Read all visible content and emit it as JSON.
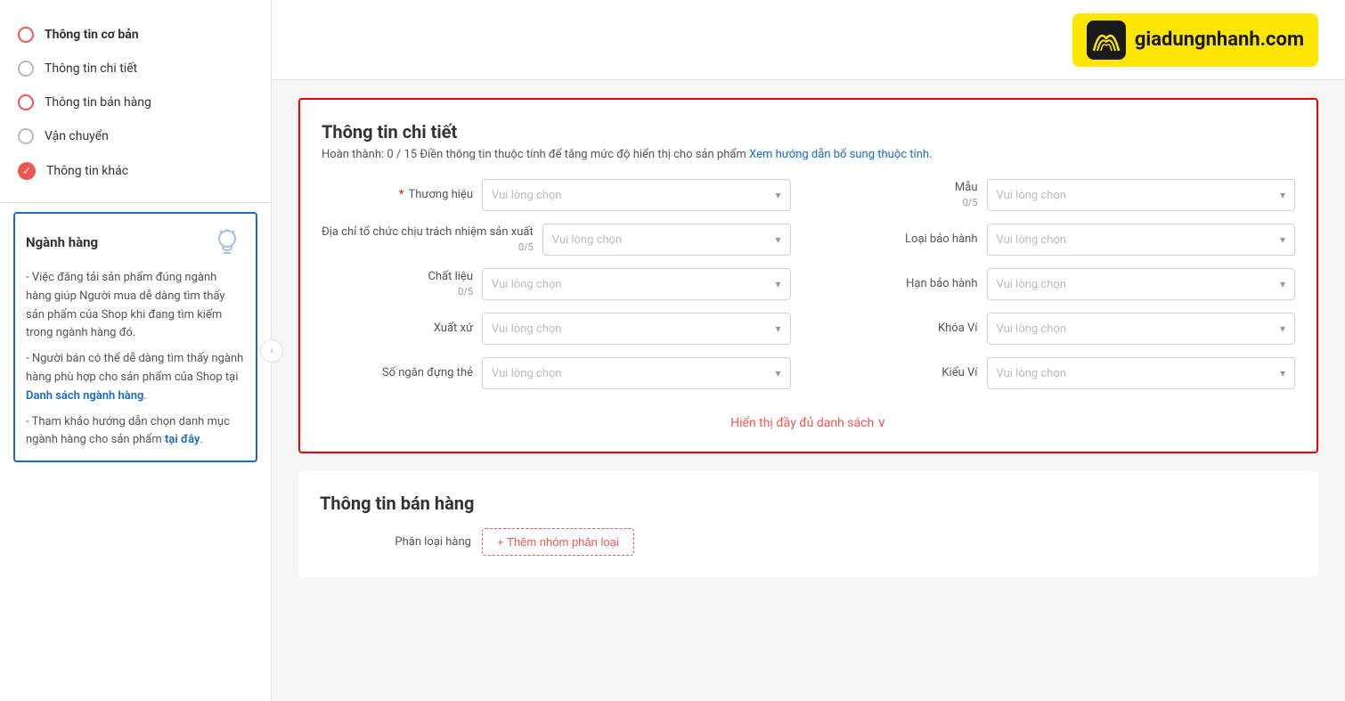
{
  "brand": {
    "logo_text": "giadungnhanh.com",
    "logo_bg": "#FFE600"
  },
  "sidebar": {
    "nav_items": [
      {
        "id": "thong-tin-co-ban",
        "label": "Thông tin cơ bản",
        "icon_type": "red-outline",
        "active": true
      },
      {
        "id": "thong-tin-chi-tiet",
        "label": "Thông tin chi tiết",
        "icon_type": "empty",
        "active": false
      },
      {
        "id": "thong-tin-ban-hang",
        "label": "Thông tin bán hàng",
        "icon_type": "red-outline",
        "active": false
      },
      {
        "id": "van-chuyen",
        "label": "Vận chuyển",
        "icon_type": "empty",
        "active": false
      },
      {
        "id": "thong-tin-khac",
        "label": "Thông tin khác",
        "icon_type": "checkmark",
        "active": false
      }
    ],
    "nganh_hang": {
      "title": "Ngành hàng",
      "description1": "- Việc đăng tải sản phẩm đúng ngành hàng giúp Người mua dễ dàng tìm thấy sản phẩm của Shop khi đang tìm kiếm trong ngành hàng đó.",
      "description2": "- Người bán có thể dễ dàng tìm thấy ngành hàng phù hợp cho sản phẩm của Shop tại",
      "link1_text": "Danh sách ngành hàng",
      "description3": "- Tham khảo hướng dẫn chọn danh mục ngành hàng cho sản phẩm",
      "link2_text": "tại đây"
    }
  },
  "thong_tin_chi_tiet": {
    "title": "Thông tin chi tiết",
    "subtitle_prefix": "Hoàn thành: 0 / 15 Điền thông tin thuộc tính để tăng mức độ hiển thị cho sản phẩm",
    "subtitle_link": "Xem hướng dẫn bổ sung thuộc tính",
    "fields_left": [
      {
        "id": "thuong-hieu",
        "label": "Thương hiệu",
        "required": true,
        "count": null,
        "placeholder": "Vui lòng chọn"
      },
      {
        "id": "dia-chi-to-chuc",
        "label": "Địa chỉ tổ chức chịu trách nhiệm sản xuất",
        "required": false,
        "count": "0/5",
        "placeholder": "Vui lòng chọn"
      },
      {
        "id": "chat-lieu",
        "label": "Chất liệu",
        "required": false,
        "count": "0/5",
        "placeholder": "Vui lòng chọn"
      },
      {
        "id": "xuat-xu",
        "label": "Xuất xứ",
        "required": false,
        "count": null,
        "placeholder": "Vui lòng chọn"
      },
      {
        "id": "so-ngan-dung-the",
        "label": "Số ngăn đựng thẻ",
        "required": false,
        "count": null,
        "placeholder": "Vui lòng chọn"
      }
    ],
    "fields_right": [
      {
        "id": "mau",
        "label": "Mẫu",
        "count": "0/5",
        "placeholder": "Vui lòng chọn"
      },
      {
        "id": "loai-bao-hanh",
        "label": "Loại bảo hành",
        "count": null,
        "placeholder": "Vui lòng chọn"
      },
      {
        "id": "han-bao-hanh",
        "label": "Hạn bảo hành",
        "count": null,
        "placeholder": "Vui lòng chọn"
      },
      {
        "id": "khoa-vi",
        "label": "Khóa Ví",
        "count": null,
        "placeholder": "Vui lòng chọn"
      },
      {
        "id": "kieu-vi",
        "label": "Kiểu Ví",
        "count": null,
        "placeholder": "Vui lòng chọn"
      }
    ],
    "show_more_label": "Hiển thị đầy đủ danh sách ∨"
  },
  "thong_tin_ban_hang": {
    "title": "Thông tin bán hàng",
    "phan_loai_label": "Phân loại hàng",
    "add_group_label": "+ Thêm nhóm phân loại"
  }
}
